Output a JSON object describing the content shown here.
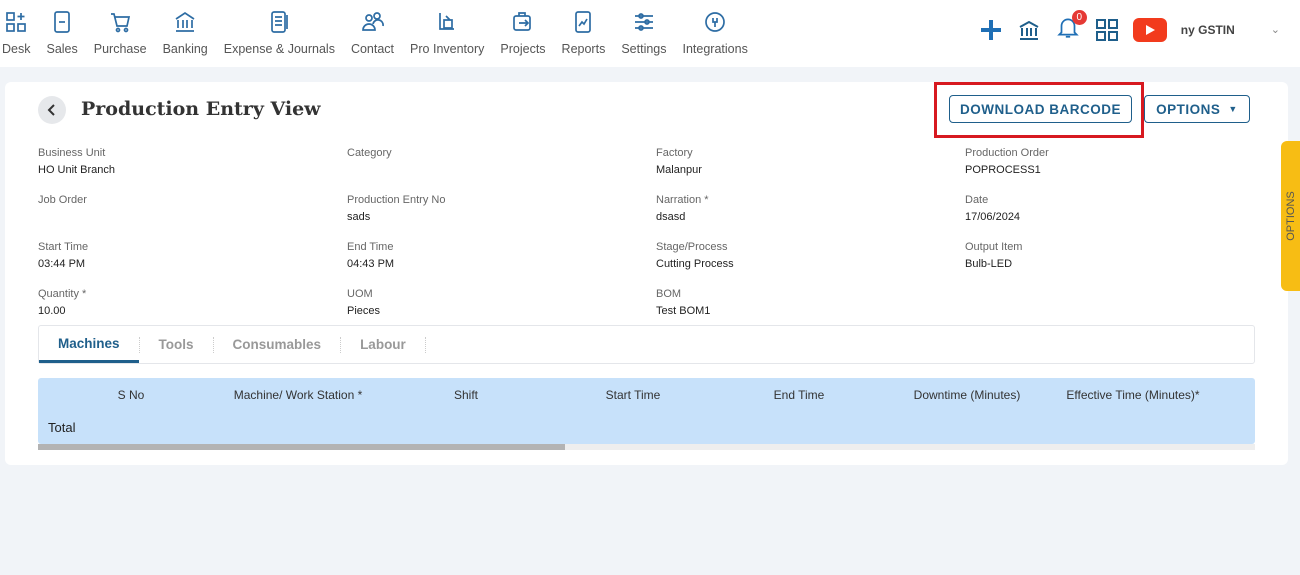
{
  "nav": [
    {
      "label": "Desk",
      "icon": "desk-icon"
    },
    {
      "label": "Sales",
      "icon": "sales-icon"
    },
    {
      "label": "Purchase",
      "icon": "cart-icon"
    },
    {
      "label": "Banking",
      "icon": "bank-icon"
    },
    {
      "label": "Expense & Journals",
      "icon": "journal-icon"
    },
    {
      "label": "Contact",
      "icon": "contact-icon"
    },
    {
      "label": "Pro Inventory",
      "icon": "inventory-icon"
    },
    {
      "label": "Projects",
      "icon": "projects-icon"
    },
    {
      "label": "Reports",
      "icon": "reports-icon"
    },
    {
      "label": "Settings",
      "icon": "settings-icon"
    },
    {
      "label": "Integrations",
      "icon": "integrations-icon"
    }
  ],
  "header": {
    "notifications": "0",
    "gstin": "ny GSTIN",
    "accent": "#1f5f8b"
  },
  "page": {
    "title": "Production Entry View",
    "download_barcode": "DOWNLOAD BARCODE",
    "options": "OPTIONS",
    "side_options": "OPTIONS"
  },
  "fields": [
    {
      "label": "Business Unit",
      "value": "HO Unit Branch"
    },
    {
      "label": "Category",
      "value": ""
    },
    {
      "label": "Factory",
      "value": "Malanpur"
    },
    {
      "label": "Production Order",
      "value": "POPROCESS1"
    },
    {
      "label": "Job Order",
      "value": ""
    },
    {
      "label": "Production Entry No",
      "value": "sads"
    },
    {
      "label": "Narration *",
      "value": "dsasd"
    },
    {
      "label": "Date",
      "value": "17/06/2024"
    },
    {
      "label": "Start Time",
      "value": "03:44 PM"
    },
    {
      "label": "End Time",
      "value": "04:43 PM"
    },
    {
      "label": "Stage/Process",
      "value": "Cutting Process"
    },
    {
      "label": "Output Item",
      "value": "Bulb-LED"
    },
    {
      "label": "Quantity *",
      "value": "10.00"
    },
    {
      "label": "UOM",
      "value": "Pieces"
    },
    {
      "label": "BOM",
      "value": "Test BOM1"
    }
  ],
  "tabs": [
    "Machines",
    "Tools",
    "Consumables",
    "Labour"
  ],
  "table": {
    "columns": [
      "S No",
      "Machine/ Work Station *",
      "Shift",
      "Start Time",
      "End Time",
      "Downtime (Minutes)",
      "Effective Time (Minutes)*"
    ],
    "total": "Total"
  }
}
